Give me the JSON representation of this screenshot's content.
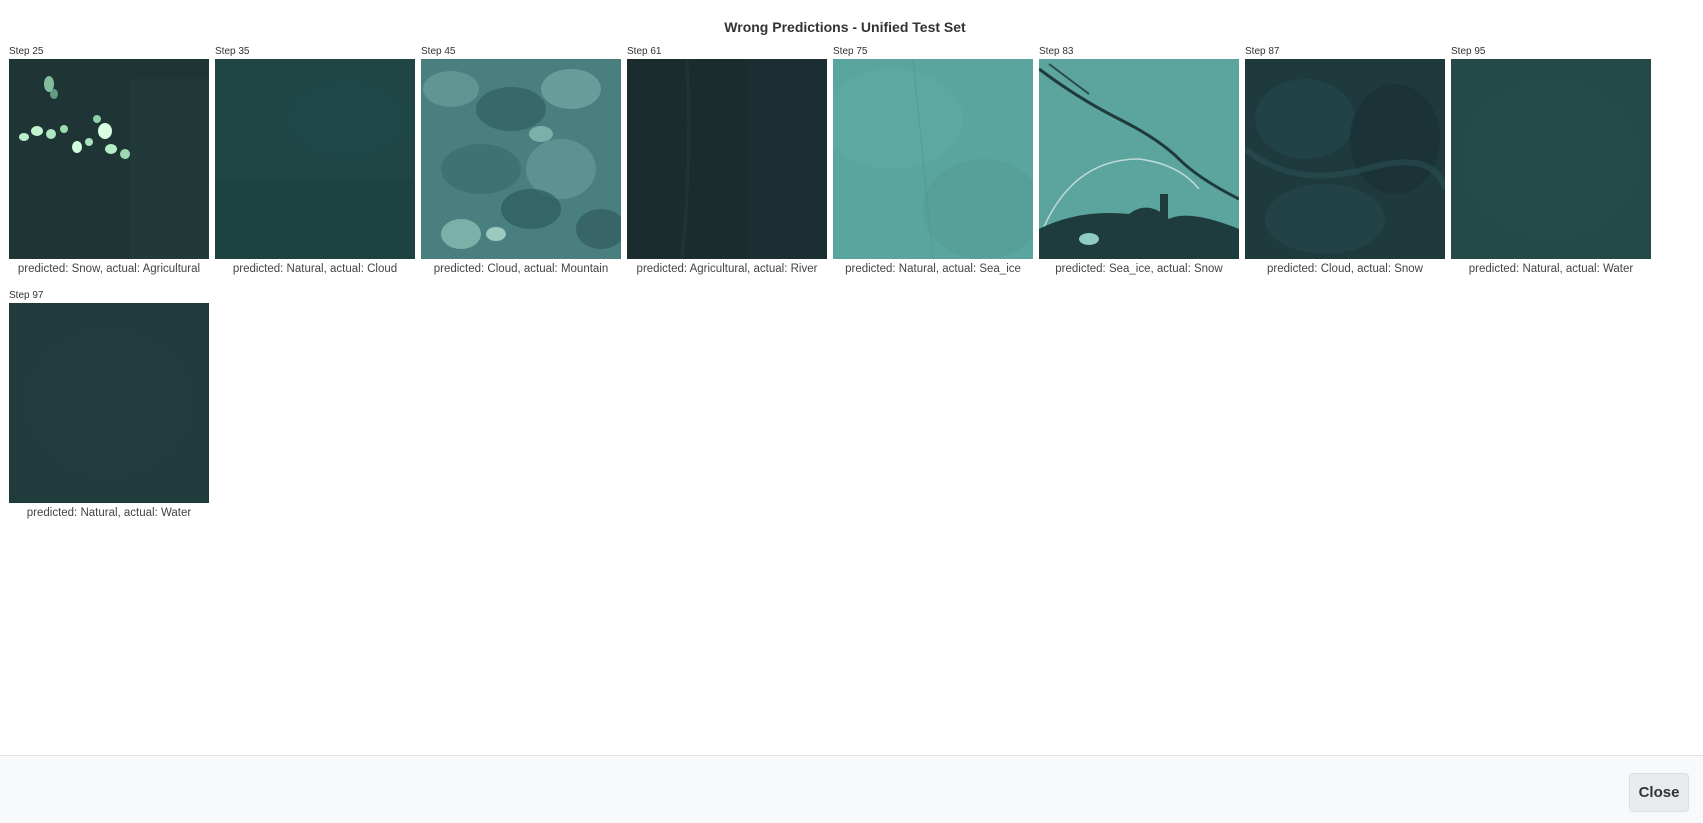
{
  "modal": {
    "title": "Wrong Predictions - Unified Test Set",
    "close_label": "Close"
  },
  "items": [
    {
      "step": "Step 25",
      "caption": "predicted: Snow, actual: Agricultural",
      "icon": "satellite-snowy-patches-image",
      "base": "#1f3535"
    },
    {
      "step": "Step 35",
      "caption": "predicted: Natural, actual: Cloud",
      "icon": "satellite-dark-teal-image",
      "base": "#1f4545"
    },
    {
      "step": "Step 45",
      "caption": "predicted: Cloud, actual: Mountain",
      "icon": "satellite-mountain-texture-image",
      "base": "#4f8585"
    },
    {
      "step": "Step 61",
      "caption": "predicted: Agricultural, actual: River",
      "icon": "satellite-very-dark-image",
      "base": "#1b2c2f"
    },
    {
      "step": "Step 75",
      "caption": "predicted: Natural, actual: Sea_ice",
      "icon": "satellite-light-teal-image",
      "base": "#5aa5a0"
    },
    {
      "step": "Step 83",
      "caption": "predicted: Sea_ice, actual: Snow",
      "icon": "satellite-ice-crack-image",
      "base": "#5ca49e"
    },
    {
      "step": "Step 87",
      "caption": "predicted: Cloud, actual: Snow",
      "icon": "satellite-dark-swirl-image",
      "base": "#1e3a3c"
    },
    {
      "step": "Step 95",
      "caption": "predicted: Natural, actual: Water",
      "icon": "satellite-water-image",
      "base": "#254949"
    },
    {
      "step": "Step 97",
      "caption": "predicted: Natural, actual: Water",
      "icon": "satellite-water-image",
      "base": "#1f3b3b"
    }
  ]
}
